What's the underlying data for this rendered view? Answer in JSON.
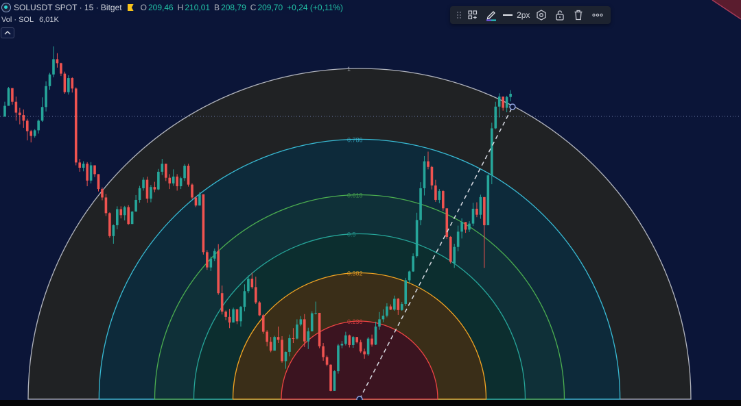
{
  "legend": {
    "title": "SOLUSDT SPOT · 15 · Bitget",
    "ohlc": [
      {
        "key": "O",
        "value": "209,46"
      },
      {
        "key": "H",
        "value": "210,01"
      },
      {
        "key": "B",
        "value": "208,79"
      },
      {
        "key": "C",
        "value": "209,70"
      }
    ],
    "change": "+0,24 (+0,11%)"
  },
  "volume": {
    "label": "Vol · SOL",
    "value": "6,01K"
  },
  "toolbar": {
    "line_width_label": "2px"
  },
  "colors": {
    "background": "#0b1538",
    "up_candle": "#26a69a",
    "down_candle": "#ef5350",
    "accent_text": "#22c3a7"
  },
  "chart_data": {
    "type": "candlestick",
    "overlay": "fibonacci-speed-resistance-arcs",
    "fib_levels": [
      {
        "value": 1,
        "label": "1",
        "color": "#b2b5be"
      },
      {
        "value": 0.786,
        "label": "0.786",
        "color": "#38bcd6"
      },
      {
        "value": 0.618,
        "label": "0.618",
        "color": "#4caf50"
      },
      {
        "value": 0.5,
        "label": "0.5",
        "color": "#26a69a"
      },
      {
        "value": 0.382,
        "label": "0.382",
        "color": "#f5a623"
      },
      {
        "value": 0.236,
        "label": "0.236",
        "color": "#ef4444"
      }
    ],
    "candles": [
      [
        222.9,
        226.6,
        222.9,
        225.6
      ],
      [
        225.6,
        230.3,
        225.6,
        230.0
      ],
      [
        230.0,
        229.9,
        225.9,
        226.6
      ],
      [
        226.6,
        227.9,
        221.9,
        223.9
      ],
      [
        223.9,
        225.1,
        221.0,
        223.3
      ],
      [
        223.3,
        224.7,
        220.1,
        221.9
      ],
      [
        221.9,
        222.4,
        217.0,
        219.3
      ],
      [
        219.3,
        219.6,
        216.5,
        218.1
      ],
      [
        218.1,
        219.8,
        217.7,
        219.5
      ],
      [
        219.5,
        222.2,
        218.7,
        221.9
      ],
      [
        221.9,
        227.7,
        221.6,
        225.3
      ],
      [
        225.3,
        231.7,
        224.2,
        230.5
      ],
      [
        230.5,
        233.8,
        229.6,
        233.4
      ],
      [
        233.4,
        240.4,
        232.7,
        237.2
      ],
      [
        237.2,
        238.7,
        235.1,
        236.2
      ],
      [
        236.2,
        236.3,
        233.0,
        233.6
      ],
      [
        233.6,
        234.1,
        228.6,
        229.0
      ],
      [
        229.0,
        233.2,
        228.4,
        232.5
      ],
      [
        232.5,
        232.7,
        228.9,
        229.9
      ],
      [
        229.9,
        230.2,
        210.8,
        211.5
      ],
      [
        211.5,
        212.4,
        209.2,
        210.2
      ],
      [
        210.2,
        211.8,
        209.3,
        211.2
      ],
      [
        211.2,
        211.6,
        205.6,
        207.0
      ],
      [
        207.0,
        211.6,
        206.3,
        210.8
      ],
      [
        210.8,
        210.8,
        207.9,
        208.6
      ],
      [
        208.6,
        208.5,
        204.3,
        204.9
      ],
      [
        204.9,
        205.3,
        202.1,
        202.8
      ],
      [
        202.8,
        203.7,
        198.2,
        198.9
      ],
      [
        198.9,
        199.1,
        192.8,
        193.2
      ],
      [
        193.2,
        196.1,
        191.3,
        195.9
      ],
      [
        195.9,
        200.6,
        194.9,
        199.9
      ],
      [
        199.9,
        200.6,
        197.6,
        198.4
      ],
      [
        198.4,
        200.7,
        197.1,
        200.4
      ],
      [
        200.4,
        200.9,
        196.0,
        196.2
      ],
      [
        196.2,
        199.4,
        196.2,
        199.3
      ],
      [
        199.3,
        203.4,
        199.3,
        202.2
      ],
      [
        202.2,
        205.7,
        201.5,
        205.1
      ],
      [
        205.1,
        207.8,
        204.5,
        207.2
      ],
      [
        207.2,
        208.0,
        201.5,
        202.5
      ],
      [
        202.5,
        205.9,
        201.6,
        205.4
      ],
      [
        205.4,
        206.7,
        204.1,
        204.8
      ],
      [
        204.8,
        209.9,
        204.6,
        209.2
      ],
      [
        209.2,
        212.4,
        208.4,
        211.2
      ],
      [
        211.2,
        210.6,
        206.9,
        207.7
      ],
      [
        207.7,
        208.6,
        204.9,
        206.3
      ],
      [
        206.3,
        209.8,
        205.7,
        208.0
      ],
      [
        208.0,
        208.6,
        204.5,
        205.6
      ],
      [
        205.6,
        208.0,
        204.9,
        207.6
      ],
      [
        207.6,
        211.1,
        206.9,
        210.7
      ],
      [
        210.7,
        211.2,
        205.5,
        206.0
      ],
      [
        206.0,
        206.3,
        202.4,
        202.8
      ],
      [
        202.8,
        203.0,
        200.4,
        200.8
      ],
      [
        200.8,
        204.1,
        200.8,
        203.6
      ],
      [
        203.6,
        201.7,
        188.6,
        189.2
      ],
      [
        189.2,
        189.7,
        184.8,
        185.4
      ],
      [
        185.4,
        188.1,
        184.5,
        187.6
      ],
      [
        187.6,
        190.1,
        187.0,
        189.5
      ],
      [
        189.5,
        191.2,
        178.6,
        179.0
      ],
      [
        179.0,
        180.9,
        173.7,
        174.4
      ],
      [
        174.4,
        174.7,
        172.3,
        173.1
      ],
      [
        173.1,
        175.1,
        170.3,
        171.7
      ],
      [
        171.7,
        175.4,
        171.7,
        175.0
      ],
      [
        175.0,
        174.3,
        171.3,
        172.0
      ],
      [
        172.0,
        175.8,
        170.7,
        175.6
      ],
      [
        175.6,
        181.2,
        174.5,
        179.5
      ],
      [
        179.5,
        183.4,
        179.0,
        182.6
      ],
      [
        182.6,
        184.1,
        180.1,
        180.5
      ],
      [
        180.5,
        183.1,
        176.3,
        176.7
      ],
      [
        176.7,
        177.0,
        173.3,
        173.5
      ],
      [
        173.5,
        173.8,
        168.9,
        169.4
      ],
      [
        169.4,
        169.8,
        165.8,
        166.9
      ],
      [
        166.9,
        168.1,
        164.3,
        164.7
      ],
      [
        164.7,
        168.4,
        164.8,
        168.1
      ],
      [
        168.1,
        170.7,
        166.6,
        167.4
      ],
      [
        167.4,
        168.3,
        161.7,
        162.1
      ],
      [
        162.1,
        164.5,
        160.2,
        164.4
      ],
      [
        164.4,
        168.7,
        163.3,
        167.8
      ],
      [
        167.8,
        170.3,
        166.6,
        167.7
      ],
      [
        167.7,
        172.5,
        167.5,
        171.2
      ],
      [
        171.2,
        173.3,
        170.8,
        172.5
      ],
      [
        172.5,
        173.8,
        165.6,
        167.0
      ],
      [
        167.0,
        170.4,
        165.1,
        169.5
      ],
      [
        169.5,
        174.5,
        169.5,
        174.0
      ],
      [
        174.0,
        176.9,
        173.7,
        174.1
      ],
      [
        174.1,
        174.0,
        165.3,
        165.8
      ],
      [
        165.8,
        166.6,
        162.2,
        163.1
      ],
      [
        163.1,
        163.5,
        160.8,
        161.2
      ],
      [
        161.2,
        161.3,
        154.6,
        154.7
      ],
      [
        154.7,
        159.8,
        154.8,
        159.6
      ],
      [
        159.6,
        166.4,
        159.0,
        166.0
      ],
      [
        166.0,
        167.1,
        165.3,
        166.4
      ],
      [
        166.4,
        169.4,
        166.0,
        168.5
      ],
      [
        168.5,
        168.7,
        165.5,
        166.1
      ],
      [
        166.1,
        168.3,
        165.4,
        168.1
      ],
      [
        168.1,
        168.0,
        166.5,
        166.8
      ],
      [
        166.8,
        167.4,
        164.1,
        164.5
      ],
      [
        164.5,
        165.2,
        162.7,
        163.8
      ],
      [
        163.8,
        168.1,
        163.4,
        167.7
      ],
      [
        167.7,
        168.7,
        165.7,
        166.2
      ],
      [
        166.2,
        171.9,
        166.1,
        170.7
      ],
      [
        170.7,
        174.3,
        169.9,
        172.5
      ],
      [
        172.5,
        175.0,
        171.8,
        173.4
      ],
      [
        173.4,
        176.5,
        173.0,
        175.7
      ],
      [
        175.7,
        176.2,
        174.8,
        174.9
      ],
      [
        174.9,
        178.4,
        174.6,
        177.6
      ],
      [
        177.6,
        177.8,
        173.6,
        174.8
      ],
      [
        174.8,
        176.8,
        174.6,
        176.3
      ],
      [
        176.3,
        182.8,
        175.8,
        182.2
      ],
      [
        182.2,
        184.6,
        181.6,
        184.4
      ],
      [
        184.4,
        188.9,
        184.3,
        188.2
      ],
      [
        188.2,
        199.0,
        187.8,
        197.2
      ],
      [
        197.2,
        206.6,
        195.9,
        205.1
      ],
      [
        205.1,
        213.1,
        203.3,
        211.8
      ],
      [
        211.8,
        214.2,
        209.8,
        210.4
      ],
      [
        210.4,
        210.7,
        204.8,
        205.8
      ],
      [
        205.8,
        207.2,
        201.7,
        202.2
      ],
      [
        202.2,
        204.9,
        201.4,
        204.4
      ],
      [
        204.4,
        204.6,
        199.5,
        200.1
      ],
      [
        200.1,
        200.1,
        192.5,
        193.0
      ],
      [
        193.0,
        193.2,
        186.4,
        186.8
      ],
      [
        186.4,
        191.3,
        185.3,
        190.5
      ],
      [
        190.5,
        195.8,
        189.4,
        194.3
      ],
      [
        194.3,
        197.6,
        192.6,
        196.7
      ],
      [
        196.7,
        196.5,
        194.0,
        194.8
      ],
      [
        194.8,
        196.9,
        194.2,
        196.3
      ],
      [
        196.3,
        201.5,
        195.7,
        200.0
      ],
      [
        200.0,
        201.6,
        197.9,
        198.5
      ],
      [
        198.5,
        203.5,
        197.5,
        202.9
      ],
      [
        202.9,
        200.8,
        185.3,
        195.9
      ],
      [
        195.9,
        208.6,
        196.3,
        208.3
      ],
      [
        208.3,
        221.4,
        206.1,
        220.0
      ],
      [
        220.0,
        226.6,
        219.8,
        225.4
      ],
      [
        225.4,
        228.7,
        222.7,
        227.9
      ],
      [
        227.9,
        227.5,
        224.4,
        225.1
      ],
      [
        225.1,
        228.1,
        224.0,
        227.8
      ],
      [
        227.8,
        229.5,
        226.7,
        228.6
      ]
    ]
  }
}
